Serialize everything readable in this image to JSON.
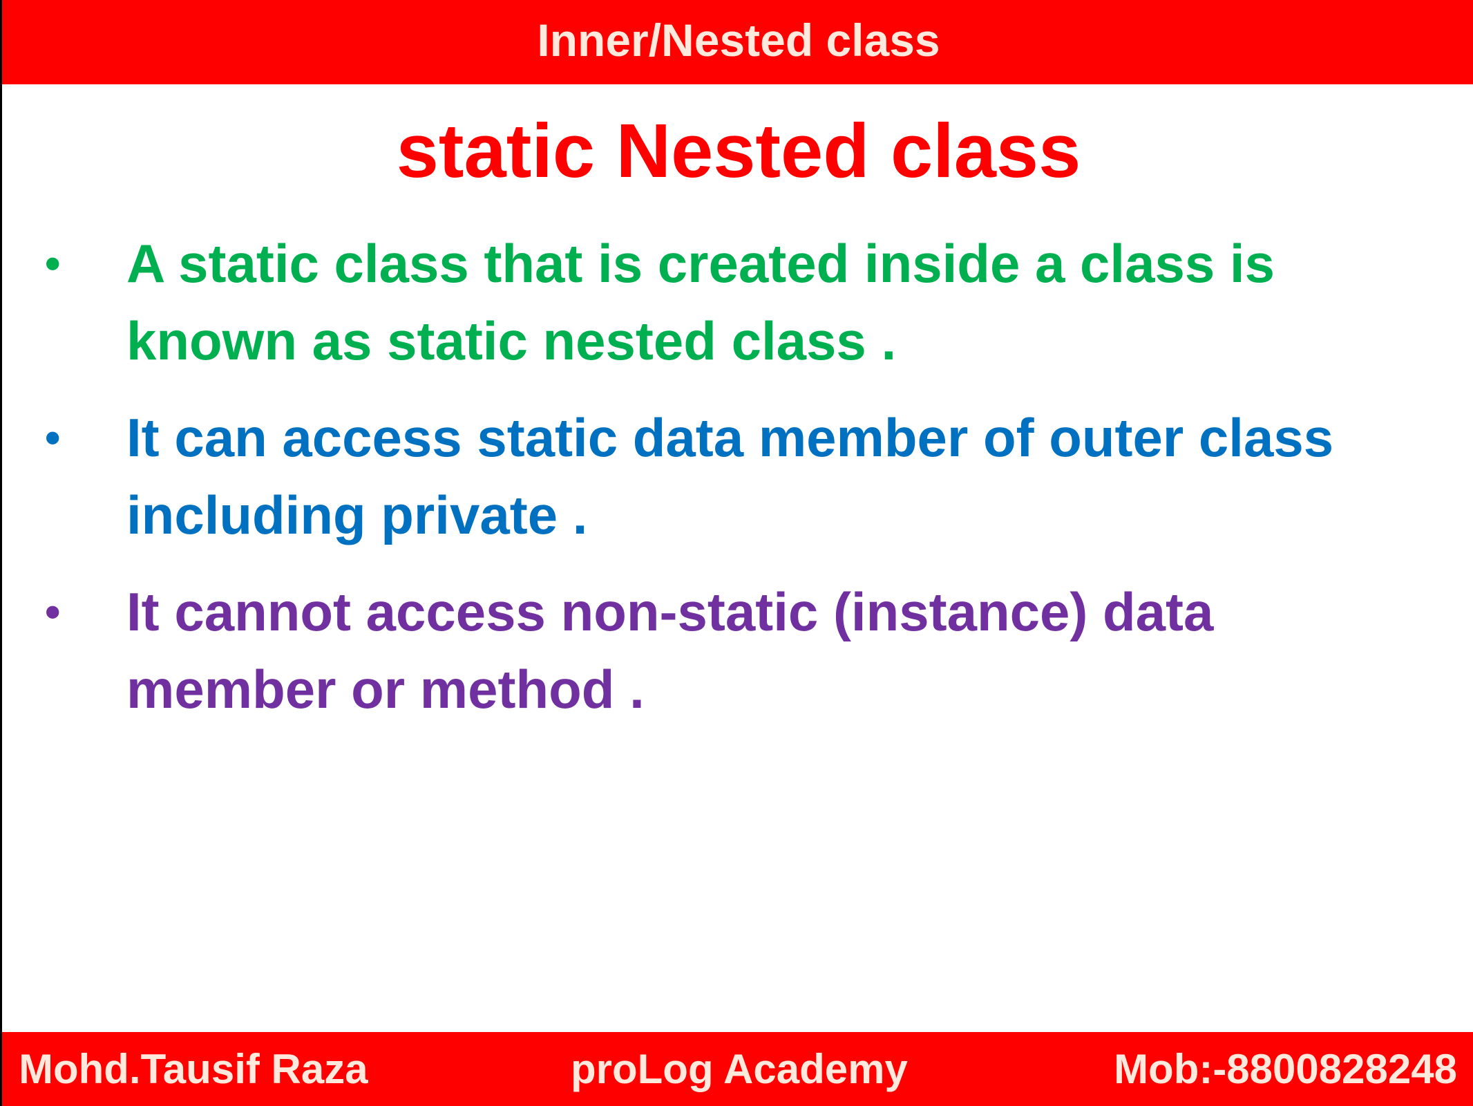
{
  "header": {
    "title": "Inner/Nested class"
  },
  "slide": {
    "title": "static Nested class",
    "bullets": [
      {
        "lines": [
          "A static class that is created inside a class is",
          "known as static nested class ."
        ],
        "color": "#00b050"
      },
      {
        "lines": [
          "It can access static data member of outer class",
          "including private ."
        ],
        "color": "#0070c0"
      },
      {
        "lines": [
          "It cannot access non-static (instance) data",
          "member or method  ."
        ],
        "color": "#7030a0"
      }
    ],
    "bullet_symbol": "•"
  },
  "footer": {
    "author": "Mohd.Tausif Raza",
    "academy": "proLog Academy",
    "mobile": "Mob:-8800828248"
  },
  "colors": {
    "banner": "#ff0000",
    "banner_text": "#ffe8dc",
    "title": "#ff0000"
  }
}
